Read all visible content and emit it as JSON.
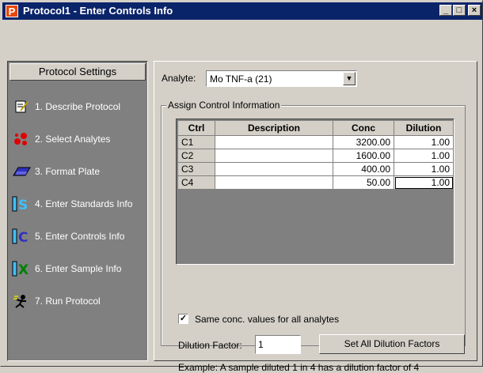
{
  "window": {
    "title": "Protocol1 - Enter Controls Info",
    "app_icon_letter": "P",
    "minimize": "_",
    "maximize": "□",
    "close": "×"
  },
  "sidebar": {
    "header": "Protocol Settings",
    "items": [
      {
        "label": "1. Describe Protocol",
        "icon": "describe-protocol-icon"
      },
      {
        "label": "2. Select Analytes",
        "icon": "select-analytes-icon"
      },
      {
        "label": "3. Format Plate",
        "icon": "format-plate-icon"
      },
      {
        "label": "4. Enter Standards Info",
        "icon": "standards-icon"
      },
      {
        "label": "5. Enter Controls Info",
        "icon": "controls-icon"
      },
      {
        "label": "6. Enter Sample Info",
        "icon": "sample-icon"
      },
      {
        "label": "7. Run Protocol",
        "icon": "run-protocol-icon"
      }
    ]
  },
  "analyte": {
    "label": "Analyte:",
    "value": "Mo TNF-a (21)"
  },
  "group": {
    "title": "Assign Control Information"
  },
  "grid": {
    "headers": [
      "Ctrl",
      "Description",
      "Conc",
      "Dilution"
    ],
    "rows": [
      {
        "ctrl": "C1",
        "description": "",
        "conc": "3200.00",
        "dilution": "1.00"
      },
      {
        "ctrl": "C2",
        "description": "",
        "conc": "1600.00",
        "dilution": "1.00"
      },
      {
        "ctrl": "C3",
        "description": "",
        "conc": "400.00",
        "dilution": "1.00"
      },
      {
        "ctrl": "C4",
        "description": "",
        "conc": "50.00",
        "dilution": "1.00"
      }
    ]
  },
  "same_conc": {
    "checked": true,
    "label": "Same conc. values for all analytes"
  },
  "dilution_factor": {
    "label": "Dilution Factor:",
    "value": "1"
  },
  "set_all_button": "Set All Dilution Factors",
  "example_text": "Example: A sample diluted 1 in 4 has a dilution factor of 4"
}
